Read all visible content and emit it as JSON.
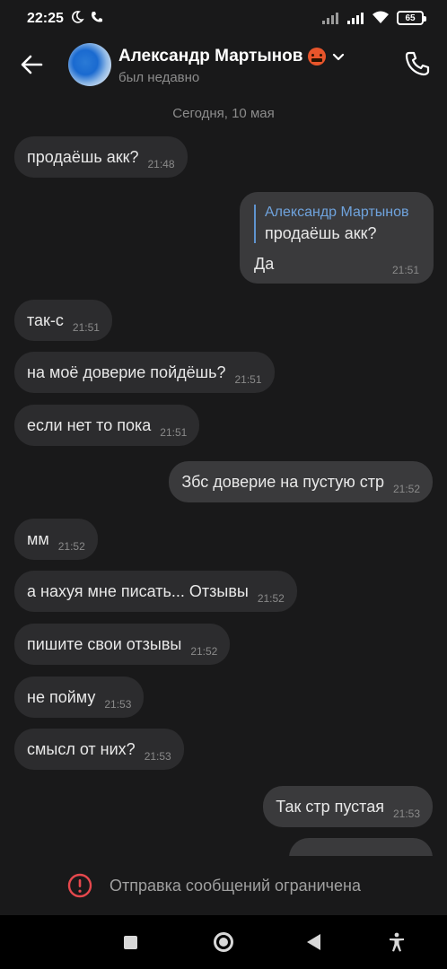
{
  "status_bar": {
    "time": "22:25",
    "battery": "65"
  },
  "header": {
    "contact_name": "Александр Мартынов",
    "contact_status": "был недавно"
  },
  "chat": {
    "date_separator": "Сегодня, 10 мая",
    "messages": [
      {
        "text": "продаёшь акк?",
        "time": "21:48",
        "direction": "in"
      },
      {
        "text": "Да",
        "time": "21:51",
        "direction": "out",
        "reply_to_name": "Александр Мартынов",
        "reply_to_text": "продаёшь акк?"
      },
      {
        "text": "так-с",
        "time": "21:51",
        "direction": "in"
      },
      {
        "text": "на моё доверие пойдёшь?",
        "time": "21:51",
        "direction": "in"
      },
      {
        "text": "если нет то пока",
        "time": "21:51",
        "direction": "in"
      },
      {
        "text": "Збс доверие на пустую стр",
        "time": "21:52",
        "direction": "out"
      },
      {
        "text": "мм",
        "time": "21:52",
        "direction": "in"
      },
      {
        "text": "а нахуя мне писать... Отзывы",
        "time": "21:52",
        "direction": "in"
      },
      {
        "text": "пишите свои отзывы",
        "time": "21:52",
        "direction": "in"
      },
      {
        "text": "не пойму",
        "time": "21:53",
        "direction": "in"
      },
      {
        "text": "смысл от них?",
        "time": "21:53",
        "direction": "in"
      },
      {
        "text": "Так стр пустая",
        "time": "21:53",
        "direction": "out"
      }
    ]
  },
  "footer": {
    "restricted_text": "Отправка сообщений ограничена"
  },
  "colors": {
    "background": "#19191a",
    "bubble_in": "#2c2c2e",
    "bubble_out": "#3a3a3c",
    "accent": "#6fa3dd",
    "warning": "#e5484d"
  }
}
